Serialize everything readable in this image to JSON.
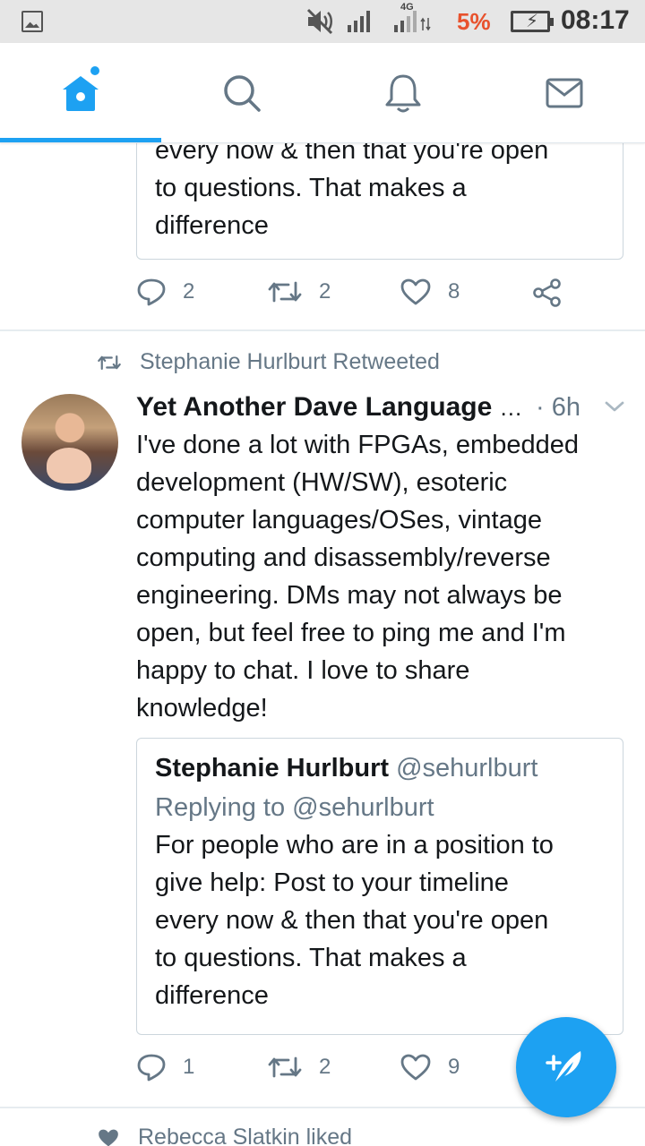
{
  "status_bar": {
    "battery_percent": "5%",
    "network": "4G",
    "time": "08:17"
  },
  "nav": {
    "tabs": [
      {
        "name": "home",
        "icon": "home-icon",
        "active": true
      },
      {
        "name": "search",
        "icon": "search-icon",
        "active": false
      },
      {
        "name": "notifications",
        "icon": "bell-icon",
        "active": false
      },
      {
        "name": "messages",
        "icon": "mail-icon",
        "active": false
      }
    ]
  },
  "feed": {
    "top_quote": {
      "lines": [
        "every now & then that you're open",
        "to questions. That makes a",
        "difference"
      ]
    },
    "top_actions": {
      "replies": "2",
      "retweets": "2",
      "likes": "8"
    },
    "tweet": {
      "context": "Stephanie Hurlburt Retweeted",
      "author_name": "Yet Another Dave Language",
      "ellipsis": "…",
      "time": "· 6h",
      "body_lines": [
        "I've done a lot with FPGAs, embedded",
        "development (HW/SW), esoteric",
        "computer languages/OSes, vintage",
        "computing and disassembly/reverse",
        "engineering. DMs may not always be",
        "open, but feel free to ping me and I'm",
        "happy to chat. I love to share",
        "knowledge!"
      ],
      "quote": {
        "author_name": "Stephanie Hurlburt",
        "author_handle": "@sehurlburt",
        "replying_to": "Replying to @sehurlburt",
        "lines": [
          "For people who are in a position to",
          "give help: Post to your timeline",
          "every now & then that you're open",
          "to questions. That makes a",
          "difference"
        ]
      },
      "actions": {
        "replies": "1",
        "retweets": "2",
        "likes": "9"
      }
    },
    "next_context": "Rebecca Slatkin liked"
  },
  "colors": {
    "accent": "#1da1f2",
    "muted": "#657786",
    "text": "#14171a",
    "battery_warning": "#e8522d"
  }
}
